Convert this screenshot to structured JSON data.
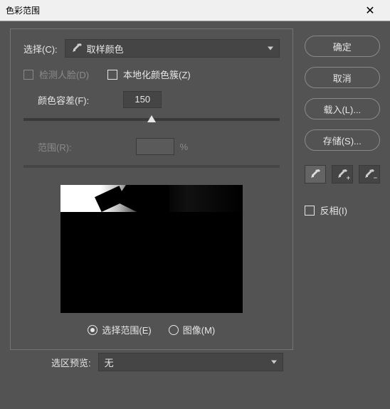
{
  "title": "色彩范围",
  "select_label": "选择(C):",
  "select_value": "取样颜色",
  "detect_faces": "检测人脸(D)",
  "localized": "本地化颜色簇(Z)",
  "fuzziness_label": "颜色容差(F):",
  "fuzziness_value": "150",
  "range_label": "范围(R):",
  "range_unit": "%",
  "radio_selection": "选择范围(E)",
  "radio_image": "图像(M)",
  "preview_label": "选区预览:",
  "preview_value": "无",
  "buttons": {
    "ok": "确定",
    "cancel": "取消",
    "load": "载入(L)...",
    "save": "存储(S)..."
  },
  "invert": "反相(I)"
}
